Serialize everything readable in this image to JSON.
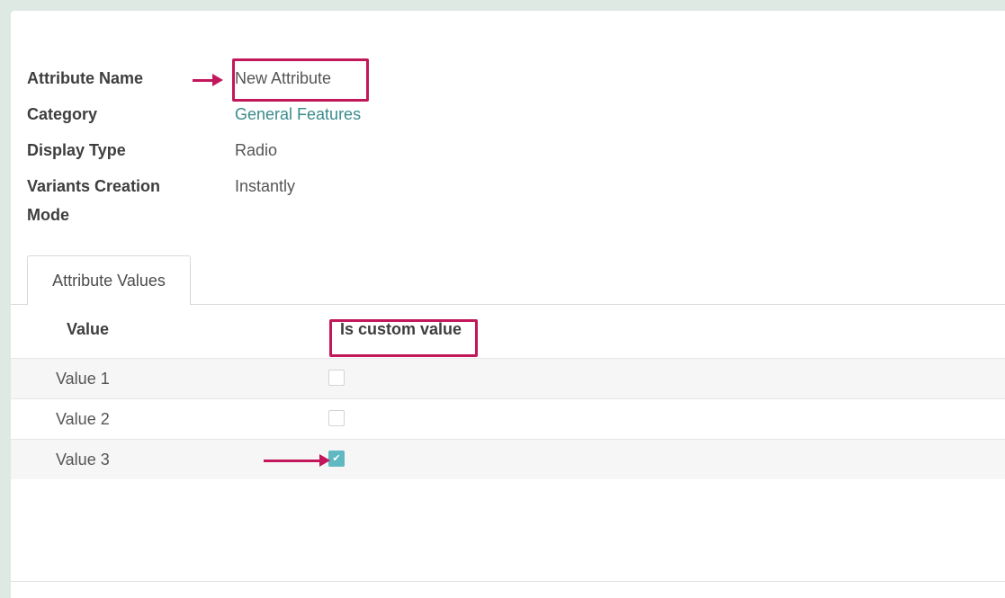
{
  "form": {
    "fields": [
      {
        "label": "Attribute Name",
        "value": "New Attribute"
      },
      {
        "label": "Category",
        "value": "General Features"
      },
      {
        "label": "Display Type",
        "value": "Radio"
      },
      {
        "label": "Variants Creation",
        "label2": "Mode",
        "value": "Instantly"
      }
    ]
  },
  "tabs": [
    {
      "label": "Attribute Values"
    }
  ],
  "table": {
    "columns": [
      "Value",
      "Is custom value"
    ],
    "rows": [
      {
        "value": "Value 1",
        "is_custom": false
      },
      {
        "value": "Value 2",
        "is_custom": false
      },
      {
        "value": "Value 3",
        "is_custom": true
      }
    ]
  },
  "colors": {
    "annotation": "#c2185b",
    "link": "#3a8b8b",
    "checkbox_checked": "#5fb8c2",
    "background": "#dfe9e4"
  },
  "icons": {
    "check": "✔"
  }
}
